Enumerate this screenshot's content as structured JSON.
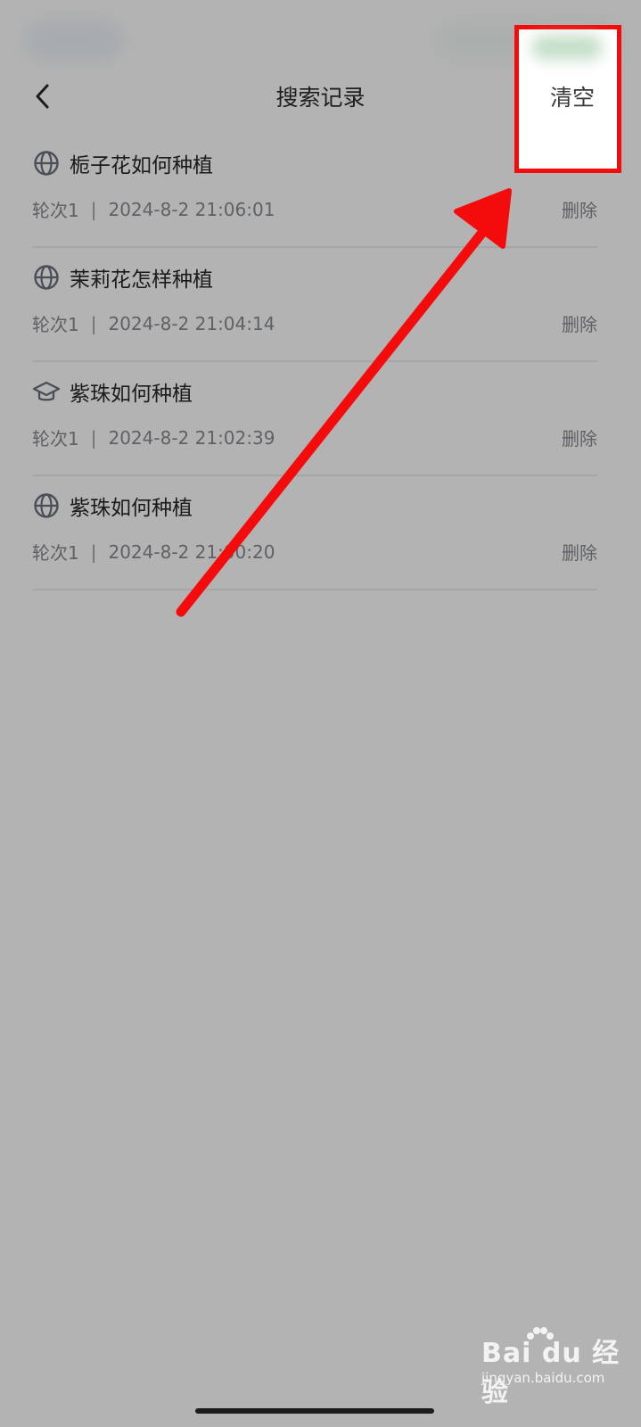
{
  "header": {
    "title": "搜索记录",
    "clear_label": "清空",
    "back_icon": "chevron-left-icon"
  },
  "history": [
    {
      "icon": "globe-icon",
      "query": "栀子花如何种植",
      "round": "轮次1",
      "separator": "|",
      "time": "2024-8-2 21:06:01",
      "delete_label": "删除"
    },
    {
      "icon": "globe-icon",
      "query": "茉莉花怎样种植",
      "round": "轮次1",
      "separator": "|",
      "time": "2024-8-2 21:04:14",
      "delete_label": "删除"
    },
    {
      "icon": "graduation-cap-icon",
      "query": "紫珠如何种植",
      "round": "轮次1",
      "separator": "|",
      "time": "2024-8-2 21:02:39",
      "delete_label": "删除"
    },
    {
      "icon": "globe-icon",
      "query": "紫珠如何种植",
      "round": "轮次1",
      "separator": "|",
      "time": "2024-8-2 21:00:20",
      "delete_label": "删除"
    }
  ],
  "annotation": {
    "highlight_color": "#f40c0c",
    "arrow_color": "#f40c0c"
  },
  "watermark": {
    "brand": "Bai du 经验",
    "url": "jingyan.baidu.com"
  }
}
